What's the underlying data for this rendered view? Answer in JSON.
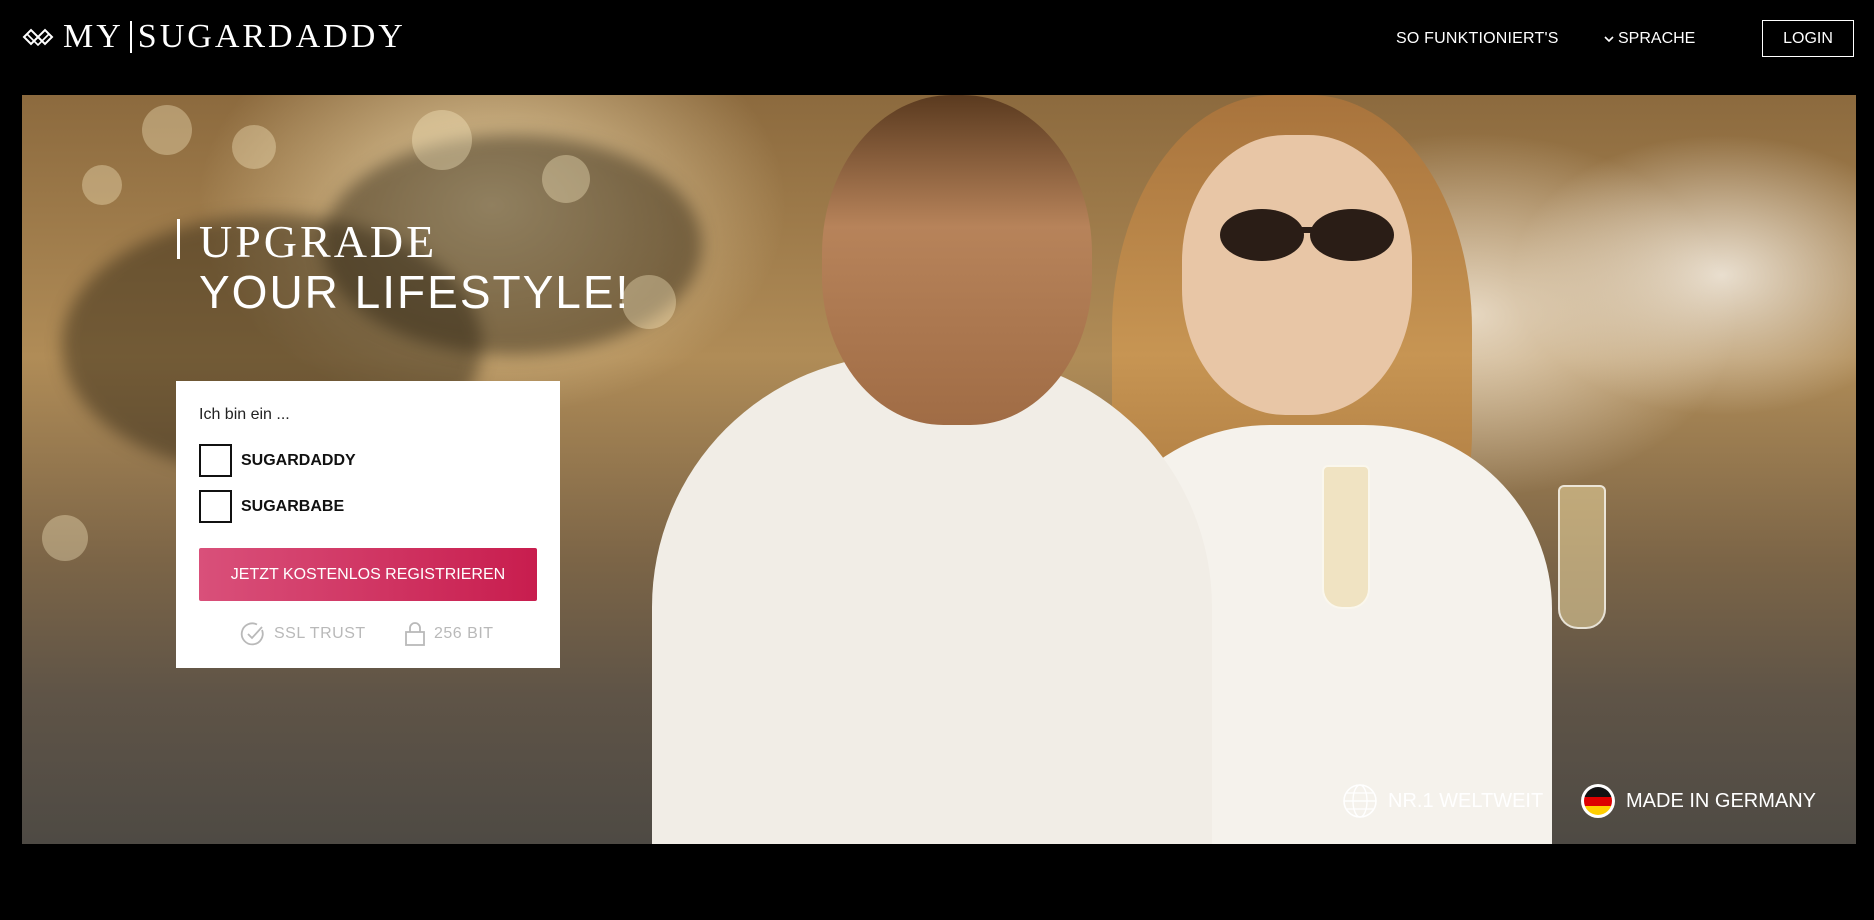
{
  "header": {
    "logo_left": "MY",
    "logo_right": "SUGARDADDY",
    "nav_how": "SO FUNKTIONIERT'S",
    "nav_language": "SPRACHE",
    "login": "LOGIN"
  },
  "hero": {
    "headline_line1": "UPGRADE",
    "headline_line2": "YOUR LIFESTYLE!"
  },
  "form": {
    "prompt": "Ich bin ein ...",
    "options": [
      {
        "label": "SUGARDADDY",
        "checked": false
      },
      {
        "label": "SUGARBABE",
        "checked": false
      }
    ],
    "register_label": "JETZT KOSTENLOS REGISTRIEREN",
    "trust_ssl": "SSL TRUST",
    "trust_bits": "256 BIT"
  },
  "badges": {
    "worldwide": "NR.1 WELTWEIT",
    "germany": "MADE IN GERMANY"
  },
  "colors": {
    "background": "#000000",
    "register_gradient_start": "#d9507a",
    "register_gradient_end": "#c81d4e",
    "trust_text": "#b9b9b9"
  },
  "icons": [
    "logo-mark-icon",
    "chevron-down-icon",
    "checkmark-circle-icon",
    "lock-icon",
    "globe-icon",
    "german-flag-icon"
  ]
}
